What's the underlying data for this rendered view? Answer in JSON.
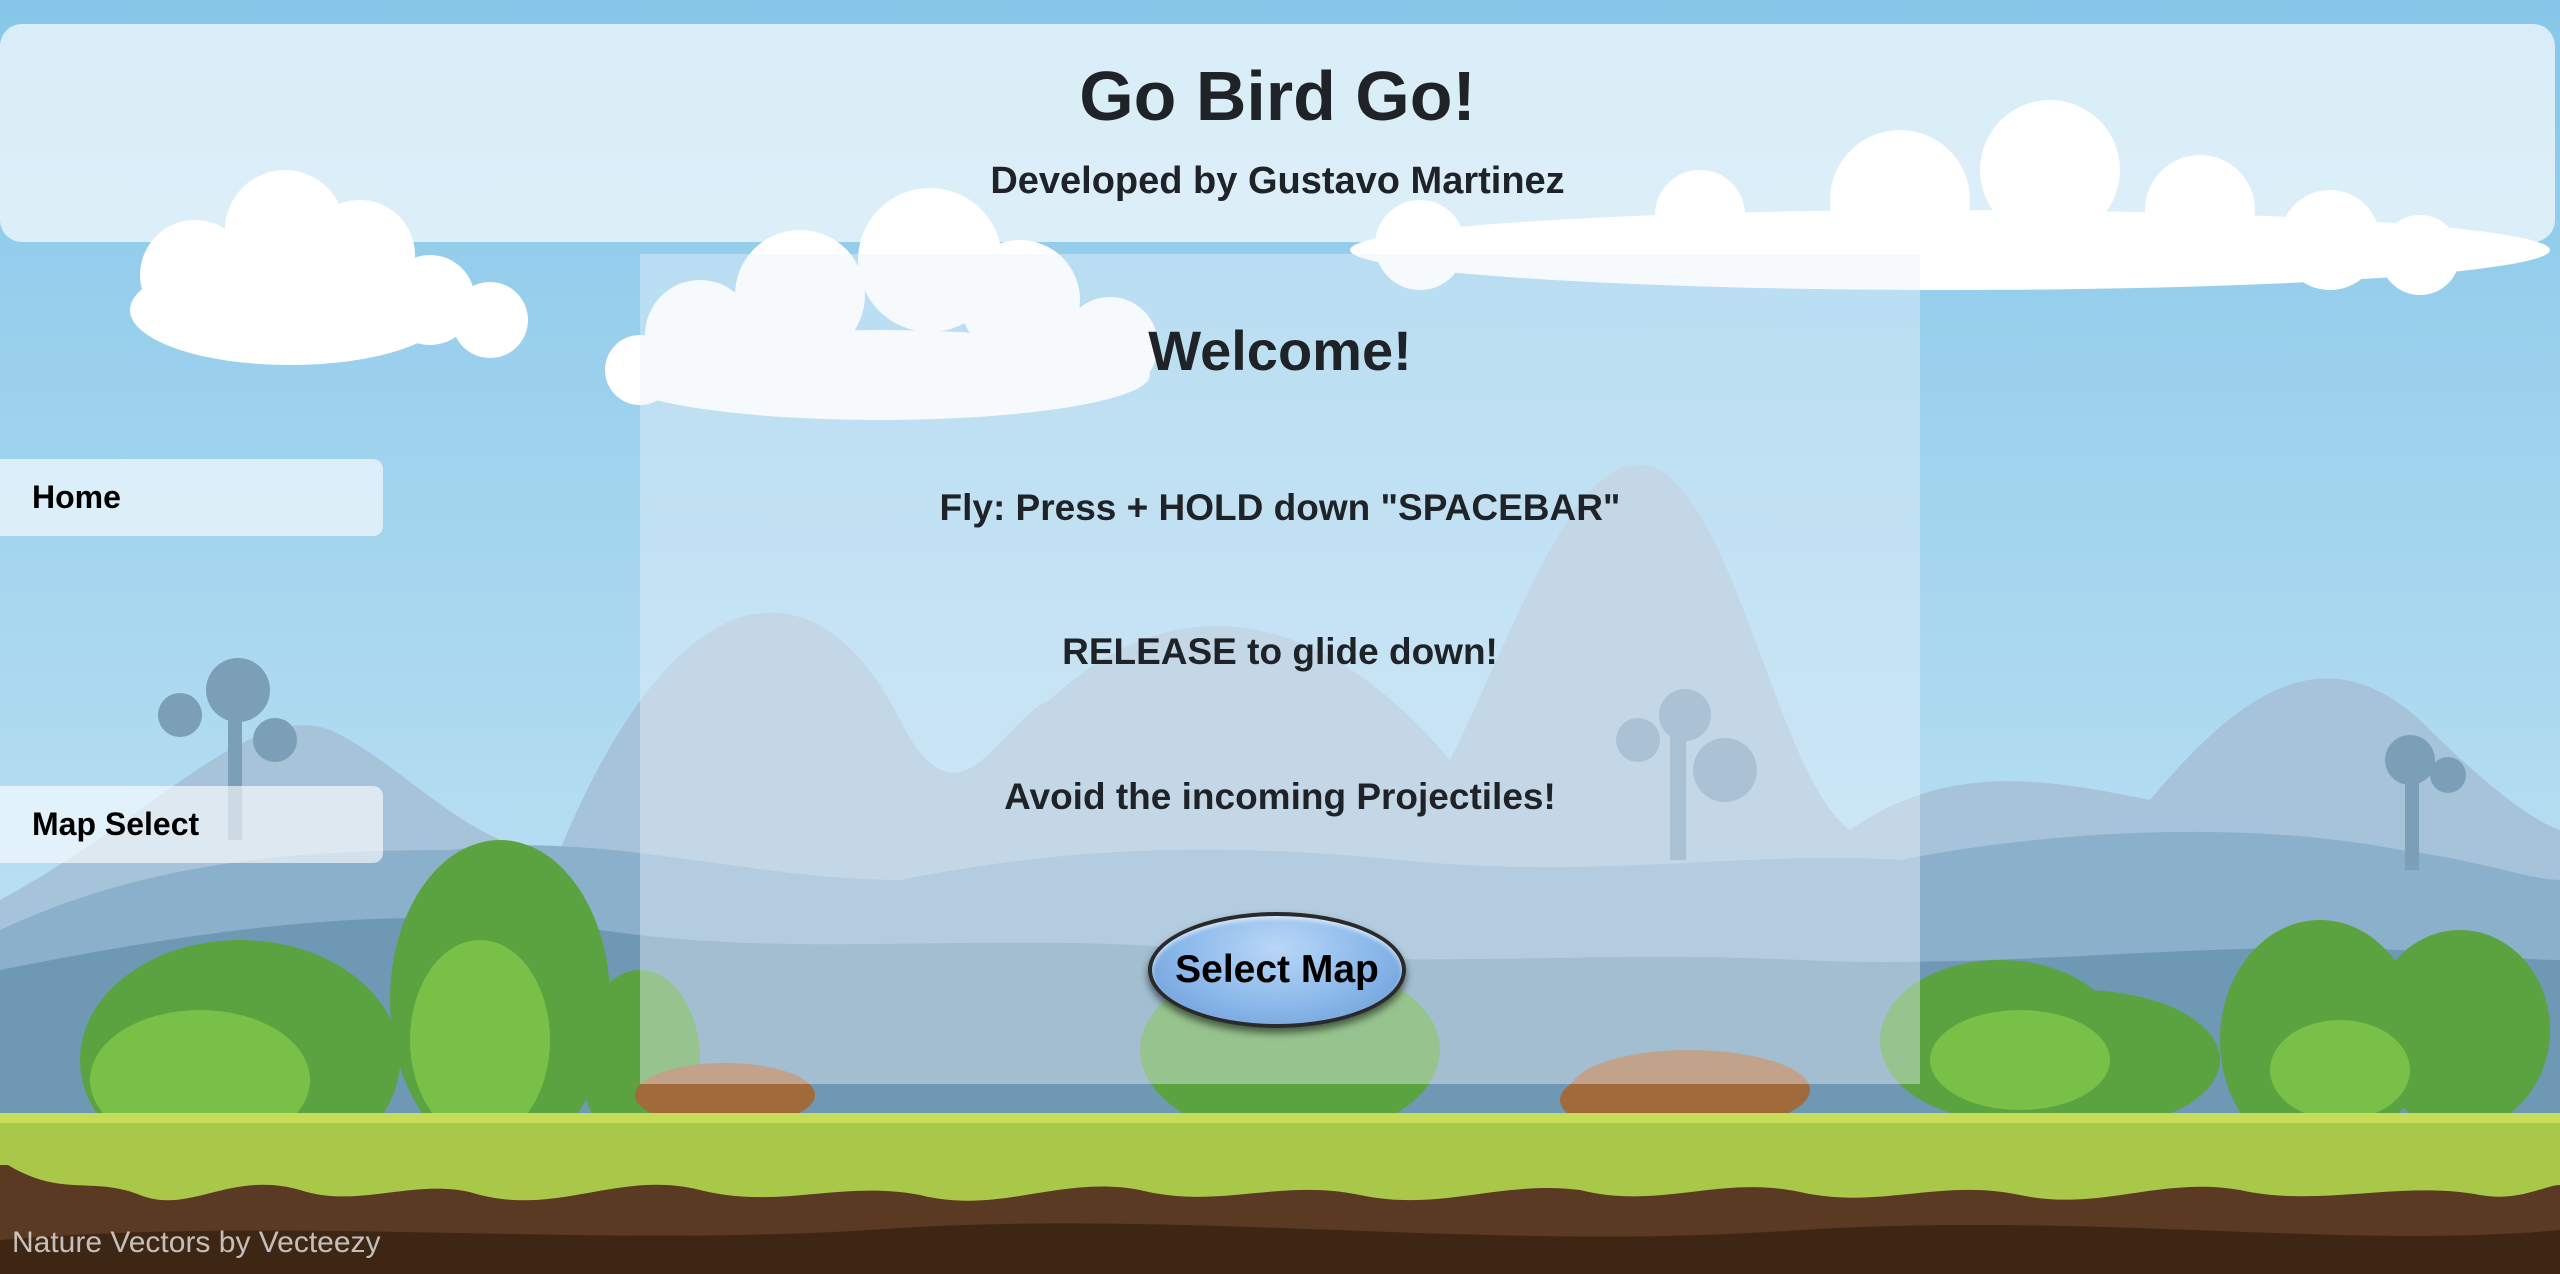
{
  "header": {
    "title": "Go Bird Go!",
    "subtitle": "Developed by Gustavo Martinez"
  },
  "sidebar": {
    "items": [
      {
        "label": "Home"
      },
      {
        "label": "Map Select"
      }
    ]
  },
  "main": {
    "welcome": "Welcome!",
    "instructions": [
      "Fly: Press + HOLD down \"SPACEBAR\"",
      "RELEASE to glide down!",
      "Avoid the incoming Projectiles!"
    ],
    "select_map_button": "Select Map"
  },
  "footer": {
    "credit": "Nature Vectors by Vecteezy"
  },
  "colors": {
    "sky": "#87c9ea",
    "grass": "#a9c84a",
    "dirt": "#5a3a22",
    "button": "#8ab8ea"
  }
}
